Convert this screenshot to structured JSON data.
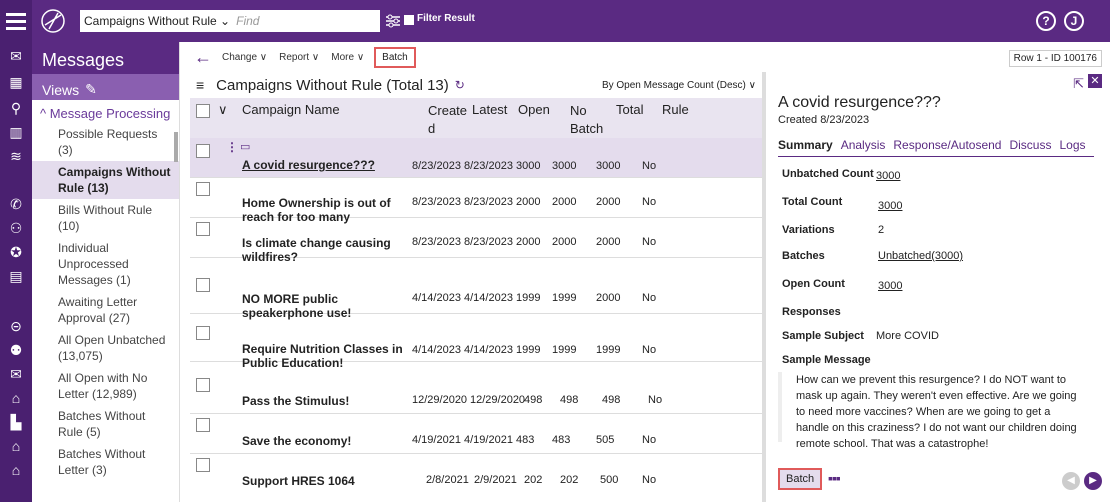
{
  "topbar": {
    "search_scope": "Campaigns Without Rule ⌄",
    "search_placeholder": "Find",
    "filter_label": "Filter Result",
    "help_icon": "?",
    "user_icon": "J"
  },
  "sidebar": {
    "title": "Messages",
    "views_label": "Views",
    "group_label": "^ Message Processing",
    "items": [
      {
        "label": "Possible Requests (3)"
      },
      {
        "label": "Campaigns Without Rule (13)"
      },
      {
        "label": "Bills Without Rule (10)"
      },
      {
        "label": "Individual Unprocessed Messages (1)"
      },
      {
        "label": "Awaiting Letter Approval (27)"
      },
      {
        "label": "All Open Unbatched (13,075)"
      },
      {
        "label": "All Open with No Letter (12,989)"
      },
      {
        "label": "Batches Without Rule (5)"
      },
      {
        "label": "Batches Without Letter (3)"
      }
    ]
  },
  "toolbar": {
    "change": "Change ∨",
    "report": "Report ∨",
    "more": "More ∨",
    "batch": "Batch",
    "row_info": "Row 1 - ID 100176"
  },
  "list": {
    "title": "Campaigns Without Rule (Total 13)",
    "sort": "By Open Message Count (Desc) ∨",
    "columns": {
      "name": "Campaign Name",
      "created": "Create d",
      "latest": "Latest",
      "open": "Open",
      "nobatch": "No Batch",
      "total": "Total",
      "rule": "Rule"
    },
    "rows": [
      {
        "name": "A covid resurgence???",
        "created": "8/23/2023",
        "latest": "8/23/2023",
        "open": "3000",
        "nobatch": "3000",
        "total": "3000",
        "rule": "No"
      },
      {
        "name": "Home Ownership is out of reach for too many",
        "created": "8/23/2023",
        "latest": "8/23/2023",
        "open": "2000",
        "nobatch": "2000",
        "total": "2000",
        "rule": "No"
      },
      {
        "name": "Is climate change causing wildfires?",
        "created": "8/23/2023",
        "latest": "8/23/2023",
        "open": "2000",
        "nobatch": "2000",
        "total": "2000",
        "rule": "No"
      },
      {
        "name": "NO MORE public speakerphone use!",
        "created": "4/14/2023",
        "latest": "4/14/2023",
        "open": "1999",
        "nobatch": "1999",
        "total": "2000",
        "rule": "No"
      },
      {
        "name": "Require Nutrition Classes in Public Education!",
        "created": "4/14/2023",
        "latest": "4/14/2023",
        "open": "1999",
        "nobatch": "1999",
        "total": "1999",
        "rule": "No"
      },
      {
        "name": "Pass the Stimulus!",
        "created": "12/29/2020",
        "latest": "12/29/2020",
        "open": "498",
        "nobatch": "498",
        "total": "498",
        "rule": "No"
      },
      {
        "name": "Save the economy!",
        "created": "4/19/2021",
        "latest": "4/19/2021",
        "open": "483",
        "nobatch": "483",
        "total": "505",
        "rule": "No"
      },
      {
        "name": "Support HRES 1064",
        "created": "2/8/2021",
        "latest": "2/9/2021",
        "open": "202",
        "nobatch": "202",
        "total": "500",
        "rule": "No"
      }
    ]
  },
  "detail": {
    "title": "A covid resurgence???",
    "created": "Created 8/23/2023",
    "tabs": [
      "Summary",
      "Analysis",
      "Response/Autosend",
      "Discuss",
      "Logs"
    ],
    "unbatched_label": "Unbatched Count",
    "unbatched_value": "3000",
    "total_label": "Total Count",
    "total_value": "3000",
    "variations_label": "Variations",
    "variations_value": "2",
    "batches_label": "Batches",
    "batches_value": "Unbatched(3000)",
    "open_label": "Open Count",
    "open_value": "3000",
    "responses_label": "Responses",
    "subject_label": "Sample Subject",
    "subject_value": "More COVID",
    "message_label": "Sample Message",
    "message": "How can we prevent this resurgence? I do NOT want to mask up again. They weren't even effective. Are we going to need more vaccines? When are we going to get a handle on this craziness? I do not want our children doing remote school. That was a catastrophe!",
    "batch_button": "Batch"
  },
  "colors": {
    "brand": "#5a2a82",
    "highlight": "#e05a5a",
    "selected_row": "#e4dced"
  }
}
